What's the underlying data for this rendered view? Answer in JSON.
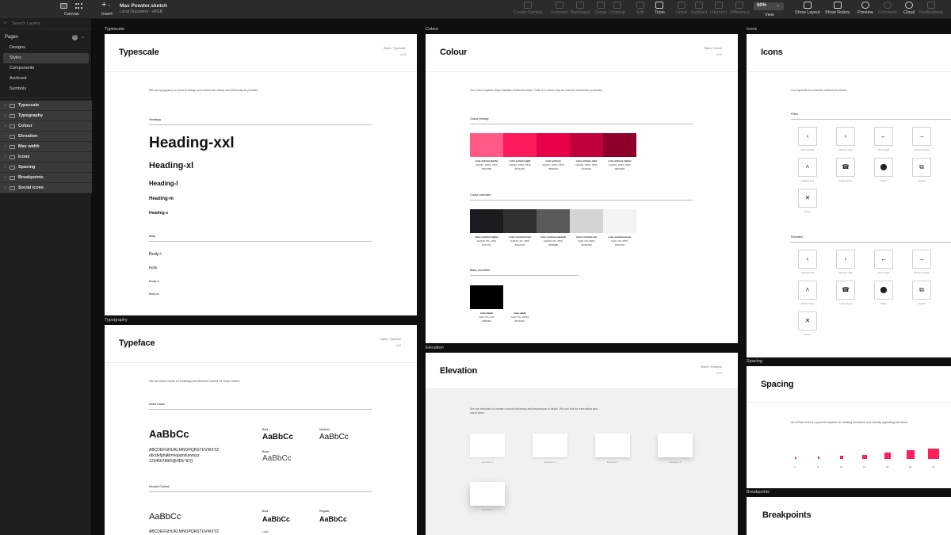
{
  "toolbar": {
    "canvas_label": "Canvas",
    "insert_label": "Insert",
    "doc_title": "Max Powder.sketch",
    "doc_sub": "Local Document - sRGB",
    "items": [
      "Create Symbol",
      "Forward",
      "Backward",
      "Group",
      "Ungroup",
      "Edit",
      "Tools",
      "Union",
      "Subtract",
      "Intersect",
      "Difference"
    ],
    "zoom": "50%",
    "view_label": "View",
    "right_items": [
      "Show Layout",
      "Show Rulers",
      "Preview",
      "Comment",
      "Cloud",
      "Notifications"
    ]
  },
  "sidebar": {
    "search_placeholder": "Search Layers",
    "pages_header": "Pages",
    "pages": [
      "Designs",
      "Styles",
      "Components",
      "Archived",
      "Symbols"
    ],
    "selected_page": "Styles",
    "artboards": [
      "Typescale",
      "Typography",
      "Colour",
      "Elevation",
      "Max width",
      "Icons",
      "Spacing",
      "Breakpoints",
      "Social icons"
    ]
  },
  "canvas": {
    "typescale": {
      "label": "Typescale",
      "title": "Typescale",
      "breadcrumb": "Styles / Typescale",
      "version": "v1.0",
      "intro": "We use typography to present design and content as clearly and efficiently as possible.",
      "headings_section": "Headings",
      "headings": [
        "Heading-xxl",
        "Heading-xl",
        "Heading-l",
        "Heading-m",
        "Heading-s"
      ],
      "body_section": "Body",
      "body": [
        "Body-l",
        "Body",
        "Body-s",
        "Body-xs"
      ]
    },
    "typography": {
      "label": "Typography",
      "title": "Typeface",
      "breadcrumb": "Styles / Typeface",
      "version": "v1.0",
      "intro": "We use Avant Garde for headings and Neuzeit Grotesk for body content",
      "font1": "Avant Garde",
      "font1_sample": "AaBbCc",
      "font1_upper": "ABCDEFGHIJKLMNOPQRSTUVWXYZ",
      "font1_lower": "abcdefghijklmnopqrstuvwxyz",
      "font1_nums": "1234567890!@#$%^&*()",
      "w_bold": "Bold",
      "w_medium": "Medium",
      "w_book": "Book",
      "font2": "Neuzeit Grotesk",
      "font2_sample": "AaBbCc",
      "font2_upper": "ABCDEFGHIJKLMNOPQRSTUVWXYZ",
      "w_bold2": "Bold",
      "w_regular": "Regular",
      "w_light": "Light"
    },
    "colour": {
      "label": "Colour",
      "title": "Colour",
      "breadcrumb": "Styles / Colour",
      "version": "v1.0",
      "intro": "Our colour system helps maintain brand and style. Tints of a colour may be used for interaction purposes.",
      "primary_section": "Colour primary",
      "primary": [
        {
          "name": "color-primary-lighter",
          "meta": "hsl(342, 100%, 70%)",
          "hex": "#FF6088",
          "color": "#ff5a86"
        },
        {
          "name": "color-primary-light",
          "meta": "hsl(342, 100%, 55%)",
          "hex": "#FF1A5C",
          "color": "#ff1a5c"
        },
        {
          "name": "color-primary",
          "meta": "hsl(342, 100%, 45%)",
          "hex": "#E60040",
          "color": "#e80048"
        },
        {
          "name": "color-primary-dark",
          "meta": "hsl(342, 100%, 38%)",
          "hex": "#C2003A",
          "color": "#c0003a"
        },
        {
          "name": "color-primary-darker",
          "meta": "hsl(342, 100%, 28%)",
          "hex": "#8F002B",
          "color": "#8e002a"
        }
      ],
      "contrasts_section": "Colour contrasts",
      "contrasts": [
        {
          "name": "color-contrast-higher",
          "meta": "hsl(240, 5%, 10%)",
          "hex": "#171721",
          "color": "#1c1c20"
        },
        {
          "name": "color-contrast-high",
          "meta": "hsl(240, 4%, 18%)",
          "hex": "#2C2C30",
          "color": "#2f2f34"
        },
        {
          "name": "color-contrast-medium",
          "meta": "hsl(240, 2%, 35%)",
          "hex": "#59595B",
          "color": "#5a5a5c"
        },
        {
          "name": "color-contrast-low",
          "meta": "hsl(0, 0%, 83%)",
          "hex": "#D3D3D3",
          "color": "#d4d4d4"
        },
        {
          "name": "color-contrast-lower",
          "meta": "hsl(0, 0%, 95%)",
          "hex": "#F2F2F2",
          "color": "#f3f3f3"
        }
      ],
      "bw_section": "Black and white",
      "bw": [
        {
          "name": "color-black",
          "meta": "hsl(0, 0%, 0%)",
          "hex": "#000000",
          "color": "#000000"
        },
        {
          "name": "color-white",
          "meta": "hsl(0, 0%, 100%)",
          "hex": "#FFFFFF",
          "color": "#ffffff"
        }
      ]
    },
    "elevation": {
      "label": "Elevation",
      "title": "Elevation",
      "breadcrumb": "Styles / Elevation",
      "version": "v1.0",
      "intro": "We use elevation to create a visual hierarchy and impression of depth. We use this for interaction and cloud clues",
      "items": [
        "Elevation 1",
        "Elevation 2",
        "Elevation 3",
        "Elevation 4",
        "Elevation 5"
      ]
    },
    "icons": {
      "label": "Icons",
      "title": "Icons",
      "intro": "Icon symbols for common actions and items.",
      "filled_section": "Filled",
      "rounded_section": "Rounded",
      "filled": [
        {
          "glyph": "‹",
          "icon": "chevron-left-icon",
          "caption": "Chevron left"
        },
        {
          "glyph": "›",
          "icon": "chevron-right-icon",
          "caption": "Chevron right"
        },
        {
          "glyph": "←",
          "icon": "arrow-back-icon",
          "caption": "Arrow back"
        },
        {
          "glyph": "→",
          "icon": "arrow-forward-icon",
          "caption": "Arrow forward"
        },
        {
          "glyph": "˄",
          "icon": "expand-less-icon",
          "caption": "Expand less"
        },
        {
          "glyph": "☎",
          "icon": "phone-icon",
          "caption": "Local phone"
        },
        {
          "glyph": "⬤",
          "icon": "place-icon",
          "caption": "Place"
        },
        {
          "glyph": "⧉",
          "icon": "launch-icon",
          "caption": "Launch"
        },
        {
          "glyph": "✕",
          "icon": "close-icon",
          "caption": "Close"
        }
      ],
      "rounded": [
        {
          "glyph": "‹",
          "icon": "chevron-left-icon",
          "caption": "Chevron left"
        },
        {
          "glyph": "›",
          "icon": "chevron-right-icon",
          "caption": "Chevron right"
        },
        {
          "glyph": "←",
          "icon": "arrow-back-icon",
          "caption": "Arrow back"
        },
        {
          "glyph": "→",
          "icon": "arrow-forward-icon",
          "caption": "Arrow forward"
        },
        {
          "glyph": "˄",
          "icon": "expand-less-icon",
          "caption": "Expand less"
        },
        {
          "glyph": "☎",
          "icon": "phone-icon",
          "caption": "Local phone"
        },
        {
          "glyph": "⬤",
          "icon": "place-icon",
          "caption": "Place"
        },
        {
          "glyph": "⧉",
          "icon": "launch-icon",
          "caption": "Launch"
        },
        {
          "glyph": "✕",
          "icon": "close-icon",
          "caption": "Close"
        }
      ]
    },
    "spacing": {
      "label": "Spacing",
      "title": "Spacing",
      "intro": "An 8-Point Grid is a powerful system for creating consistent and visually appealing interfaces.",
      "values": [
        "4",
        "8",
        "12",
        "16",
        "24",
        "32",
        "40"
      ],
      "accent": "#ff1f5c"
    },
    "breakpoints": {
      "label": "Breakpoints",
      "title": "Breakpoints"
    }
  }
}
